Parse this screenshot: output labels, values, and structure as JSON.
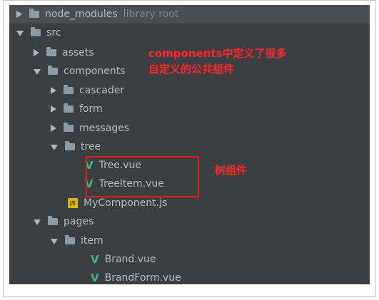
{
  "tree": {
    "node_modules": {
      "label": "node_modules",
      "suffix": "library root"
    },
    "src": "src",
    "assets": "assets",
    "components": "components",
    "cascader": "cascader",
    "form": "form",
    "messages": "messages",
    "tree": "tree",
    "tree_vue": "Tree.vue",
    "treeitem_vue": "TreeItem.vue",
    "mycomponent_js": "MyComponent.js",
    "pages": "pages",
    "item": "item",
    "brand_vue": "Brand.vue",
    "brandform_vue": "BrandForm.vue"
  },
  "icons": {
    "vue": "V",
    "js": "JS"
  },
  "annotations": {
    "components_line1": "components中定义了很多",
    "components_line2": "自定义的公共组件",
    "tree_note": "树组件"
  },
  "colors": {
    "panel_bg": "#3c3f41",
    "annotation_red": "#ff2a2a",
    "vue_green": "#41b883"
  }
}
